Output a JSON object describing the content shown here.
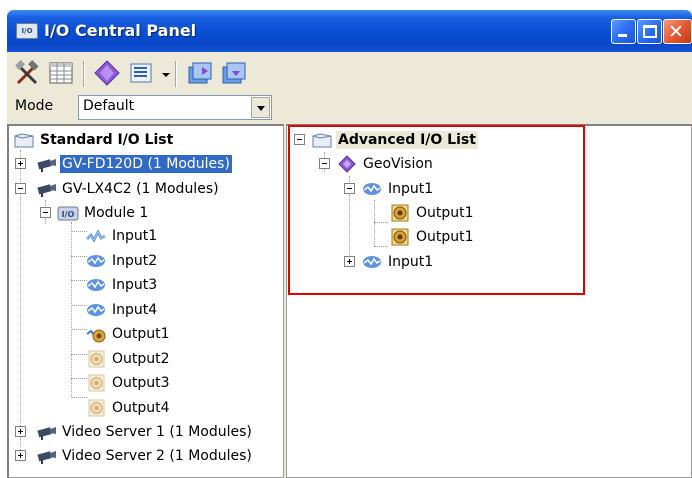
{
  "window": {
    "title": "I/O Central Panel",
    "title_icon_text": "I/O"
  },
  "toolbar": {
    "tools": [
      "settings-tools-icon",
      "grid-table-icon",
      "geovision-diamond-icon",
      "list-view-icon",
      "dropdown-arrow",
      "export-io-icon",
      "import-io-icon"
    ]
  },
  "mode": {
    "label": "Mode",
    "value": "Default"
  },
  "standard_list": {
    "root_label": "Standard I/O List",
    "devices": [
      "GV-FD120D (1 Modules)",
      "GV-LX4C2 (1 Modules)",
      "Video Server 1 (1 Modules)",
      "Video Server 2 (1 Modules)"
    ],
    "module_label": "Module 1",
    "module_icon_text": "I/O",
    "ports": [
      "Input1",
      "Input2",
      "Input3",
      "Input4",
      "Output1",
      "Output2",
      "Output3",
      "Output4"
    ]
  },
  "advanced_list": {
    "root_label": "Advanced I/O List",
    "group_label": "GeoVision",
    "input_a": "Input1",
    "outputs": [
      "Output1",
      "Output1"
    ],
    "input_b": "Input1"
  },
  "colors": {
    "titlebar": "#0a4fd6",
    "selection": "#316ac5",
    "highlight_box": "#e00000",
    "window_face": "#ece9d8"
  }
}
